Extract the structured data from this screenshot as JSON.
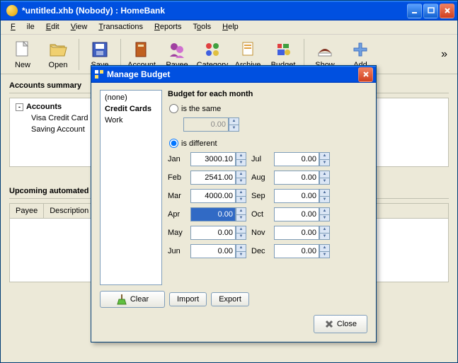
{
  "window": {
    "title": "*untitled.xhb (Nobody) : HomeBank"
  },
  "menubar": {
    "file": "File",
    "edit": "Edit",
    "view": "View",
    "transactions": "Transactions",
    "reports": "Reports",
    "tools": "Tools",
    "help": "Help"
  },
  "toolbar": {
    "new": "New",
    "open": "Open",
    "save": "Save",
    "account": "Account",
    "payee": "Payee",
    "category": "Category",
    "archive": "Archive",
    "budget": "Budget",
    "show": "Show",
    "add": "Add"
  },
  "main": {
    "accounts_title": "Accounts summary",
    "accounts_header": "Accounts",
    "account_rows": [
      "Visa Credit Card",
      "Saving Account"
    ],
    "upcoming_title": "Upcoming automated",
    "col_payee": "Payee",
    "col_desc": "Description"
  },
  "dialog": {
    "title": "Manage Budget",
    "categories": [
      "(none)",
      "Credit Cards",
      "Work"
    ],
    "selected_index": 1,
    "budget_title": "Budget for each month",
    "radio_same": "is the same",
    "radio_diff": "is different",
    "same_value": "0.00",
    "months_left": [
      {
        "label": "Jan",
        "value": "3000.10"
      },
      {
        "label": "Feb",
        "value": "2541.00"
      },
      {
        "label": "Mar",
        "value": "4000.00"
      },
      {
        "label": "Apr",
        "value": "0.00",
        "selected": true
      },
      {
        "label": "May",
        "value": "0.00"
      },
      {
        "label": "Jun",
        "value": "0.00"
      }
    ],
    "months_right": [
      {
        "label": "Jul",
        "value": "0.00"
      },
      {
        "label": "Aug",
        "value": "0.00"
      },
      {
        "label": "Sep",
        "value": "0.00"
      },
      {
        "label": "Oct",
        "value": "0.00"
      },
      {
        "label": "Nov",
        "value": "0.00"
      },
      {
        "label": "Dec",
        "value": "0.00"
      }
    ],
    "clear": "Clear",
    "import": "Import",
    "export": "Export",
    "close": "Close"
  }
}
